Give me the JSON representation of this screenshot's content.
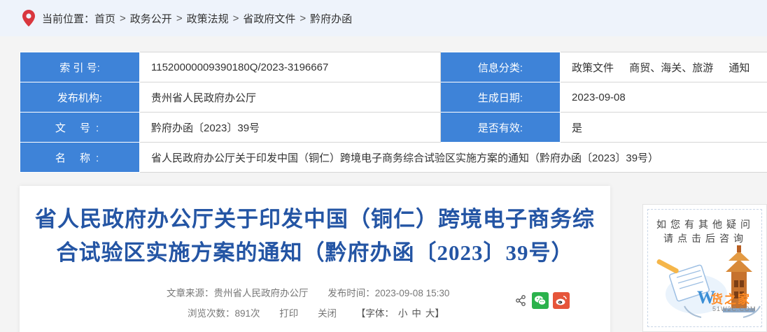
{
  "breadcrumb": {
    "location_label": "当前位置：",
    "items": [
      "首页",
      "政务公开",
      "政策法规",
      "省政府文件",
      "黔府办函"
    ],
    "separator": ">"
  },
  "info": {
    "index_label": "索 引 号:",
    "index_value": "11520000009390180Q/2023-3196667",
    "category_label": "信息分类:",
    "category_values": [
      "政策文件",
      "商贸、海关、旅游",
      "通知"
    ],
    "publisher_label": "发布机构:",
    "publisher_value": "贵州省人民政府办公厅",
    "date_label": "生成日期:",
    "date_value": "2023-09-08",
    "doc_label": "文 号:",
    "doc_value": "黔府办函〔2023〕39号",
    "valid_label": "是否有效:",
    "valid_value": "是",
    "name_label": "名 称:",
    "name_value": "省人民政府办公厅关于印发中国（铜仁）跨境电子商务综合试验区实施方案的通知（黔府办函〔2023〕39号）"
  },
  "article": {
    "title_line1": "省人民政府办公厅关于印发中国（铜仁）跨境电子商务综",
    "title_line2": "合试验区实施方案的通知（黔府办函〔2023〕39号）",
    "source": "文章来源：贵州省人民政府办公厅",
    "publish_time": "发布时间：2023-09-08 15:30",
    "views": "浏览次数：891次",
    "print": "打印",
    "close": "关闭",
    "font_label": "【字体：",
    "font_small": "小",
    "font_medium": "中",
    "font_large": "大】"
  },
  "side": {
    "line1": "如您有其他疑问",
    "line2": "请点击后咨询"
  },
  "watermark": {
    "text": "货之家",
    "sub": "51W2C.COM"
  },
  "colors": {
    "label_bg": "#3e83d8",
    "title": "#2455a4",
    "pin": "#d9363e",
    "wechat": "#2bb24c",
    "weibo": "#e6553a"
  },
  "icons": [
    "location-pin-icon",
    "share-icon",
    "wechat-icon",
    "weibo-icon"
  ]
}
